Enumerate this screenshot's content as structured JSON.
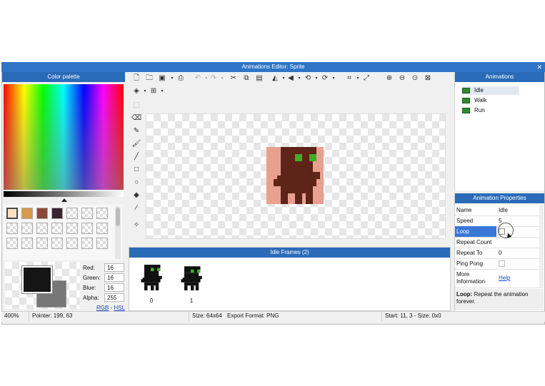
{
  "window": {
    "title": "Animations Editor: Sprite",
    "close_glyph": "✕"
  },
  "palette": {
    "header": "Color palette",
    "swatches": [
      "#fde0c0",
      "#d89a4c",
      "#8a4a3a",
      "#3a2430"
    ],
    "current_color": "#151515",
    "secondary_color": "#777777",
    "red_label": "Red:",
    "red_value": "16",
    "green_label": "Green:",
    "green_value": "16",
    "blue_label": "Blue:",
    "blue_value": "16",
    "alpha_label": "Alpha:",
    "alpha_value": "255",
    "rgb_link": "RGB",
    "separator": " - ",
    "hsl_link": "HSL"
  },
  "toolbar": {
    "icons": [
      "new-file-icon",
      "open-folder-icon",
      "save-icon",
      "export-icon",
      "undo-icon",
      "redo-icon",
      "cut-icon",
      "copy-icon",
      "paste-icon",
      "flip-horizontal-icon",
      "flip-vertical-icon",
      "rotate-left-icon",
      "rotate-right-icon",
      "crop-icon",
      "resize-icon",
      "zoom-in-icon",
      "zoom-out-icon",
      "zoom-fit-icon",
      "actual-size-icon",
      "layers-icon",
      "grid-icon"
    ]
  },
  "tools": [
    "select-tool-icon",
    "eraser-tool-icon",
    "pencil-tool-icon",
    "brush-tool-icon",
    "line-tool-icon",
    "rectangle-tool-icon",
    "ellipse-tool-icon",
    "fill-tool-icon",
    "eyedropper-tool-icon",
    "magic-wand-tool-icon"
  ],
  "frames": {
    "header": "Idle Frames (2)",
    "items": [
      {
        "label": "0"
      },
      {
        "label": "1"
      }
    ]
  },
  "animations": {
    "header": "Animations",
    "items": [
      {
        "label": "Idle",
        "selected": true
      },
      {
        "label": "Walk",
        "selected": false
      },
      {
        "label": "Run",
        "selected": false
      }
    ]
  },
  "properties": {
    "header": "Animation Properties",
    "rows": [
      {
        "name": "Name",
        "value": "Idle"
      },
      {
        "name": "Speed",
        "value": "5"
      },
      {
        "name": "Loop",
        "value": ""
      },
      {
        "name": "Repeat Count",
        "value": ""
      },
      {
        "name": "Repeat To",
        "value": "0"
      },
      {
        "name": "Ping Pong",
        "value": ""
      }
    ],
    "more_info_label": "More Information",
    "help_link": "Help",
    "description_title": "Loop:",
    "description_text": " Repeat the animation forever."
  },
  "status": {
    "zoom": "400%",
    "pointer": "Pointer: 199, 63",
    "size": "Size: 64x64",
    "export_format": "Export Format: PNG",
    "selection": "Start: 11, 3 - Size: 0x0"
  },
  "colors": {
    "accent": "#2a6bb8",
    "sprite_bg": "#e8a090",
    "sprite_body": "#5e2418",
    "sprite_eye": "#3fae2a"
  }
}
